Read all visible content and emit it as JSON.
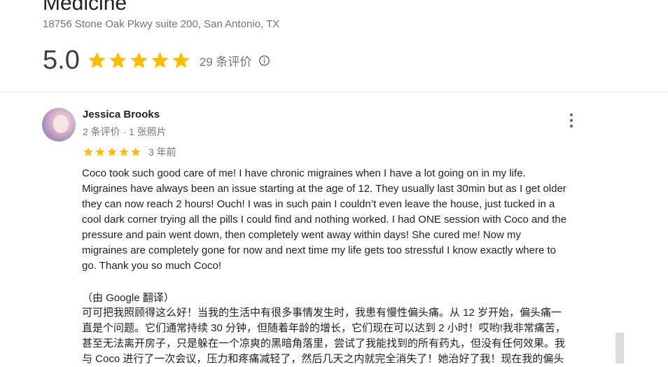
{
  "business": {
    "name": "Medicine",
    "address": "18756 Stone Oak Pkwy suite 200, San Antonio, TX"
  },
  "rating": {
    "score": "5.0",
    "stars": 5,
    "review_count": "29 条评价",
    "info_icon": "info-circle-icon",
    "star_color": "#fbbc04"
  },
  "review": {
    "author": "Jessica Brooks",
    "author_meta": "2 条评价 · 1 张照片",
    "stars": 5,
    "date": "3 年前",
    "more_icon": "more-vertical-icon",
    "text": "Coco took such good care of me! I have chronic migraines when I have a lot going on in my life.\nMigraines have always been an issue starting at the age of 12. They usually last 30min but as I get older\nthey can now reach 2 hours! Ouch! I was in such pain I couldn’t even leave the house, just tucked in a\ncool dark corner trying all the pills I could find and nothing worked. I had ONE session with Coco and the\npressure and pain went down, then completely went away within days! She cured me! Now my\nmigraines are completely gone for now and next time my life gets too stressful I know exactly where to\ngo. Thank you so much Coco!",
    "translated_label": "（由 Google 翻译）",
    "translated_text": "可可把我照顾得这么好！当我的生活中有很多事情发生时，我患有慢性偏头痛。从 12 岁开始，偏头痛一\n直是个问题。它们通常持续 30 分钟，但随着年龄的增长，它们现在可以达到 2 小时！哎哟!我非常痛苦，\n甚至无法离开房子，只是躲在一个凉爽的黑暗角落里，尝试了我能找到的所有药丸，但没有任何效果。我\n与 Coco 进行了一次会议，压力和疼痛减轻了，然后几天之内就完全消失了！她治好了我！现在我的偏头"
  }
}
